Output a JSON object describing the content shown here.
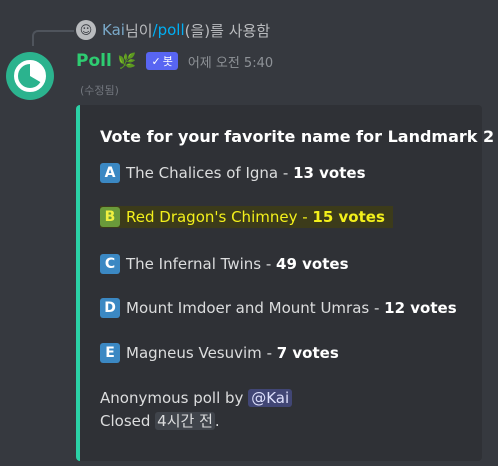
{
  "reply": {
    "user": "Kai",
    "text_mid": " 님이 ",
    "command": "/poll",
    "text_end": "(을)를 사용함"
  },
  "header": {
    "username": "Poll",
    "emoji": "🌿",
    "bot_tag": "봇",
    "timestamp": "어제 오전 5:40",
    "edited": "(수정됨)"
  },
  "embed": {
    "accent_color": "#2bd1a6",
    "title": "Vote for your favorite name for Landmark 2",
    "options": [
      {
        "letter": "A",
        "name": "The Chalices of Igna",
        "sep": " - ",
        "votes": "13 votes"
      },
      {
        "letter": "B",
        "name": "Red Dragon's Chimney",
        "sep": " - ",
        "votes": "15 votes"
      },
      {
        "letter": "C",
        "name": "The Infernal Twins",
        "sep": " - ",
        "votes": "49 votes"
      },
      {
        "letter": "D",
        "name": "Mount Imdoer and Mount Umras",
        "sep": " - ",
        "votes": "12 votes"
      },
      {
        "letter": "E",
        "name": "Magneus Vesuvim",
        "sep": " - ",
        "votes": "7 votes"
      }
    ],
    "footer": {
      "anon_label": "Anonymous poll by ",
      "mention": "@Kai",
      "closed_label": "Closed ",
      "closed_time": "4시간 전",
      "period": "."
    }
  }
}
